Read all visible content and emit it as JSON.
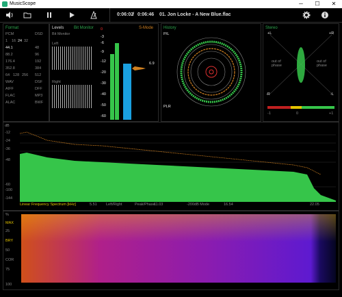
{
  "titlebar": {
    "title": "MusicScope",
    "minimize": "─",
    "maximize": "☐",
    "close": "✕"
  },
  "toolbar": {
    "time_elapsed": "0:06:02",
    "time_sep": "/",
    "time_total": "0:06:46",
    "track": "01. Jon Locke - A New Blue.flac"
  },
  "format": {
    "title": "Format",
    "col1": [
      "PCM",
      "1",
      "44.1",
      "88.2",
      "176.4",
      "352.8",
      "64",
      "WAV",
      "AIFF",
      "FLAC",
      "ALAC"
    ],
    "col2": [
      "DSD",
      "",
      "48",
      "96",
      "192",
      "384",
      "512",
      "DSF",
      "DFF",
      "MP3",
      "BWF"
    ],
    "bits": [
      "16",
      "24",
      "32"
    ],
    "bits2": [
      "128",
      "256"
    ]
  },
  "levels": {
    "title": "Levels",
    "bit_monitor": "Bit Monitor",
    "left": "Left",
    "right": "Right",
    "smode": "S-Mode",
    "value": "6.9",
    "scale": [
      "0",
      "-3",
      "-6",
      "-9",
      "-12",
      "-20",
      "-30",
      "-40",
      "-50",
      "-60"
    ],
    "l_label": "L",
    "r_label": "R",
    "lr": "LU"
  },
  "history": {
    "title": "History",
    "pl": "P/L",
    "plr": "PLR"
  },
  "stereo": {
    "title": "Stereo",
    "l_top": "+L",
    "r_top": "+R",
    "l_bot": "-R",
    "r_bot": "-L",
    "out_left": "out of phase",
    "out_right": "out of phase",
    "scale": [
      "-1",
      "0",
      "+1"
    ]
  },
  "spectrum": {
    "ylabels": [
      "dB",
      "-12",
      "-24",
      "-36",
      "-48",
      "-60",
      "-100",
      "-144"
    ],
    "title": "Linear Frequency Spectrum [kHz]",
    "xlabels": [
      "5.51",
      "Left/Right",
      "Peak/Phase",
      "11.03",
      "-200dB Mode",
      "16.54",
      "22.05"
    ]
  },
  "spectrogram": {
    "ylabels": [
      "%",
      "MAX",
      "25",
      "BRY",
      "50",
      "COR",
      "75",
      "100"
    ]
  },
  "colors": {
    "green": "#2fa84f",
    "bar_green": "#36c54a",
    "orange": "#d08020",
    "blue": "#1aa0e0"
  }
}
